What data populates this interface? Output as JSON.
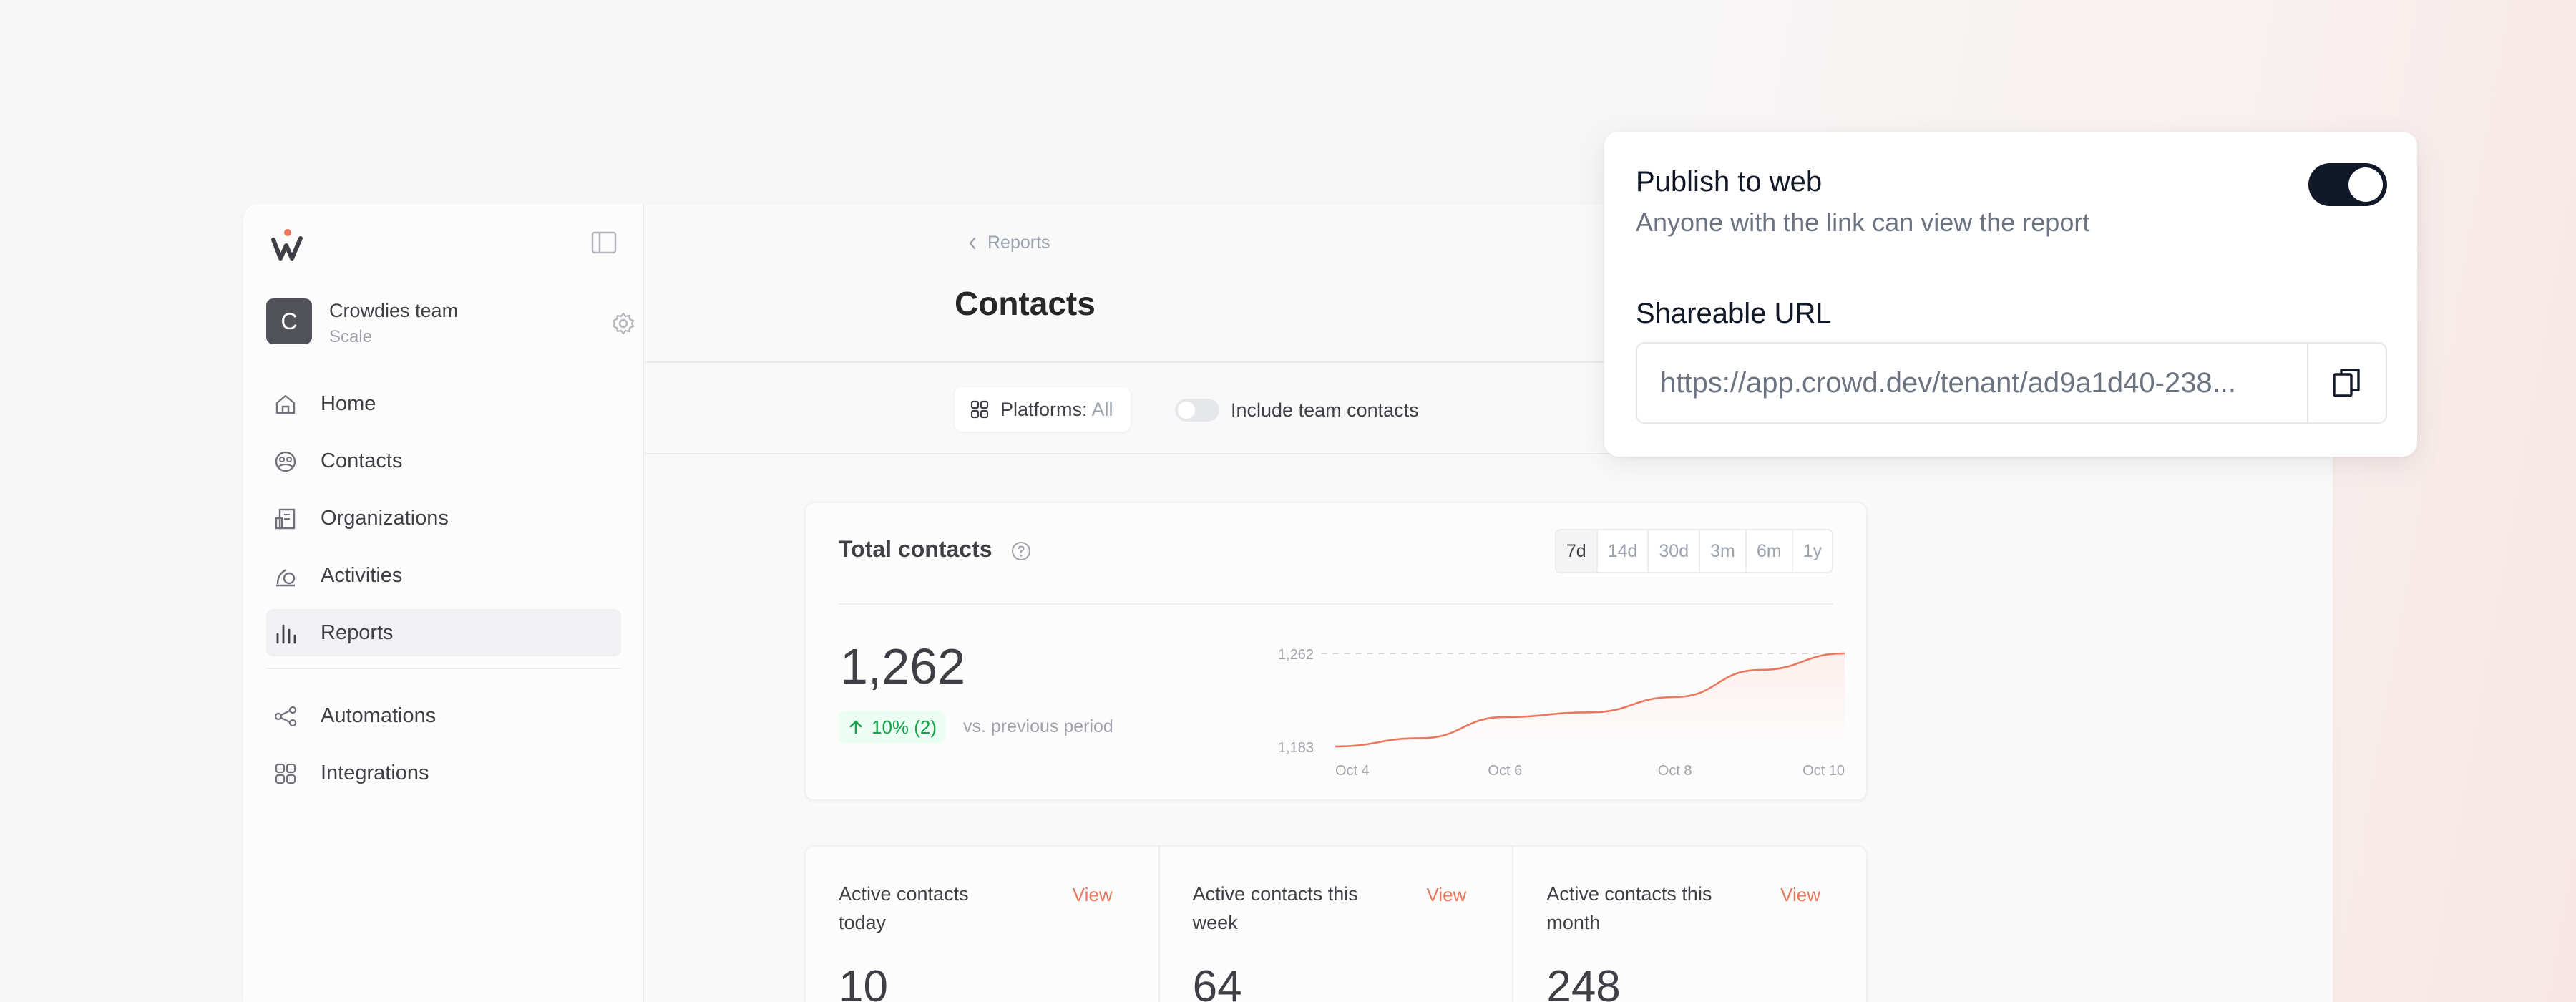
{
  "workspace": {
    "initial": "C",
    "name": "Crowdies team",
    "plan": "Scale"
  },
  "sidebar": {
    "items": [
      {
        "label": "Home",
        "icon": "home-icon"
      },
      {
        "label": "Contacts",
        "icon": "contacts-icon"
      },
      {
        "label": "Organizations",
        "icon": "organizations-icon"
      },
      {
        "label": "Activities",
        "icon": "activities-icon"
      },
      {
        "label": "Reports",
        "icon": "reports-icon",
        "active": true
      }
    ],
    "secondary_items": [
      {
        "label": "Automations",
        "icon": "automations-icon"
      },
      {
        "label": "Integrations",
        "icon": "integrations-icon"
      }
    ]
  },
  "header": {
    "breadcrumb": "Reports",
    "title": "Contacts"
  },
  "filters": {
    "platforms_label": "Platforms:",
    "platforms_value": "All",
    "include_team_label": "Include team contacts",
    "include_team_enabled": false
  },
  "total_card": {
    "title": "Total contacts",
    "ranges": [
      "7d",
      "14d",
      "30d",
      "3m",
      "6m",
      "1y"
    ],
    "selected_range": "7d",
    "value": "1,262",
    "delta": "10% (2)",
    "delta_note": "vs. previous period"
  },
  "chart_data": {
    "type": "area",
    "x": [
      "Oct 4",
      "Oct 5",
      "Oct 6",
      "Oct 7",
      "Oct 8",
      "Oct 9",
      "Oct 10"
    ],
    "values": [
      1183,
      1190,
      1208,
      1212,
      1225,
      1248,
      1262
    ],
    "tick_labels_x": [
      "Oct 4",
      "Oct 6",
      "Oct 8",
      "Oct 10"
    ],
    "tick_labels_y": [
      "1,262",
      "1,183"
    ],
    "ylim": [
      1183,
      1262
    ],
    "color": "#e9785f",
    "grid": false
  },
  "stats": [
    {
      "label": "Active contacts today",
      "view": "View",
      "value": "10"
    },
    {
      "label": "Active contacts this week",
      "view": "View",
      "value": "64"
    },
    {
      "label": "Active contacts this month",
      "view": "View",
      "value": "248"
    }
  ],
  "publish": {
    "title": "Publish to web",
    "subtitle": "Anyone with the link can view the report",
    "enabled": true,
    "url_label": "Shareable URL",
    "url": "https://app.crowd.dev/tenant/ad9a1d40-238..."
  },
  "colors": {
    "accent": "#e9785f",
    "dark": "#111827",
    "success": "#16a34a"
  }
}
